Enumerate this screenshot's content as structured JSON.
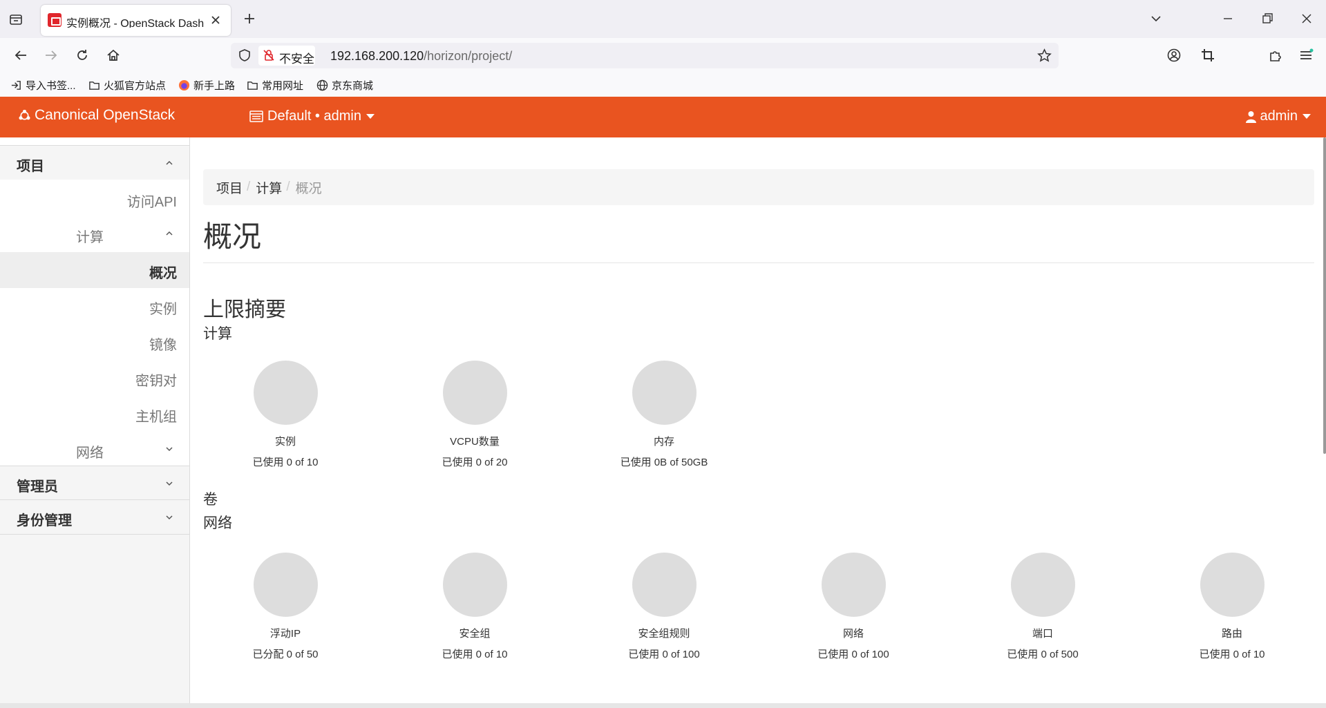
{
  "browser": {
    "tab_title": "实例概况 - OpenStack Dashboard",
    "url_security": "不安全",
    "url_host": "192.168.200.120",
    "url_path": "/horizon/project/",
    "bookmarks": [
      "导入书签...",
      "火狐官方站点",
      "新手上路",
      "常用网址",
      "京东商城"
    ]
  },
  "header": {
    "brand": "Canonical OpenStack",
    "project_selector": "Default • admin",
    "user_menu": "admin"
  },
  "sidebar": {
    "project_label": "项目",
    "access_api": "访问API",
    "compute_label": "计算",
    "compute_items": [
      "概况",
      "实例",
      "镜像",
      "密钥对",
      "主机组"
    ],
    "network_label": "网络",
    "admin_label": "管理员",
    "identity_label": "身份管理"
  },
  "breadcrumb": [
    "项目",
    "计算",
    "概况"
  ],
  "page": {
    "title": "概况",
    "limits_heading": "上限摘要",
    "compute_heading": "计算",
    "volume_heading": "卷",
    "network_heading": "网络"
  },
  "compute_limits": [
    {
      "label": "实例",
      "usage": "已使用 0 of 10",
      "used_fraction": 0
    },
    {
      "label": "VCPU数量",
      "usage": "已使用 0 of 20",
      "used_fraction": 0
    },
    {
      "label": "内存",
      "usage": "已使用 0B of 50GB",
      "used_fraction": 0
    }
  ],
  "network_limits": [
    {
      "label": "浮动IP",
      "usage": "已分配 0 of 50",
      "used_fraction": 0
    },
    {
      "label": "安全组",
      "usage": "已使用 0 of 10",
      "used_fraction": 0
    },
    {
      "label": "安全组规则",
      "usage": "已使用 0 of 100",
      "used_fraction": 0
    },
    {
      "label": "网络",
      "usage": "已使用 0 of 100",
      "used_fraction": 0
    },
    {
      "label": "端口",
      "usage": "已使用 0 of 500",
      "used_fraction": 0
    },
    {
      "label": "路由",
      "usage": "已使用 0 of 10",
      "used_fraction": 0
    }
  ],
  "colors": {
    "brand_orange": "#e95420",
    "pie_empty": "#dddddd",
    "insecure_red": "#e0262c"
  },
  "icons": {
    "tab_list": "tab-list-icon",
    "back": "back-arrow-icon",
    "forward": "forward-arrow-icon",
    "reload": "reload-icon",
    "home": "home-icon",
    "shield": "shield-icon",
    "insecure": "insecure-lock-icon",
    "star": "bookmark-star-icon",
    "account": "account-icon",
    "crop": "screenshot-crop-icon",
    "extensions": "extensions-icon",
    "menu": "hamburger-menu-icon"
  }
}
